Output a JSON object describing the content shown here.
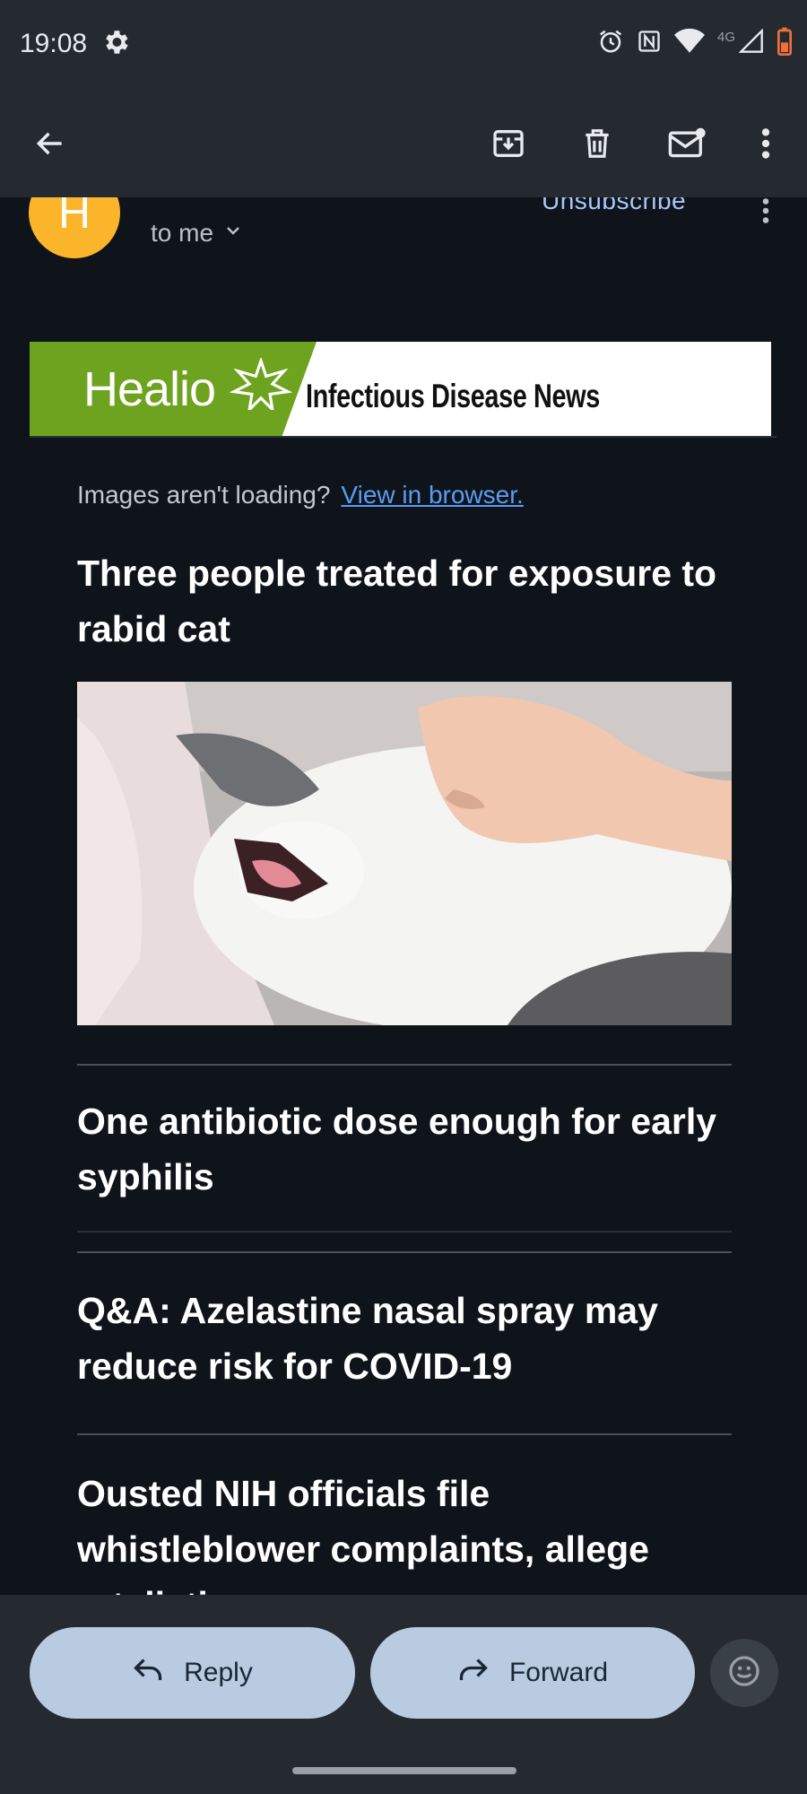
{
  "status_bar": {
    "time": "19:08",
    "network": "4G"
  },
  "email": {
    "sender_initial": "H",
    "recipient_label": "to me",
    "unsubscribe_label": "Unsubscribe"
  },
  "banner": {
    "brand": "Healio",
    "publication": "Infectious Disease News"
  },
  "content": {
    "images_notice": "Images aren't loading?",
    "view_in_browser": "View in browser.",
    "articles": [
      {
        "title": "Three people treated for exposure to rabid cat"
      },
      {
        "title": "One antibiotic dose enough for early syphilis"
      },
      {
        "title": "Q&A: Azelastine nasal spray may reduce risk for COVID-19"
      },
      {
        "title": "Ousted NIH officials file whistleblower complaints, allege retaliation"
      }
    ]
  },
  "actions": {
    "reply": "Reply",
    "forward": "Forward"
  },
  "colors": {
    "avatar": "#fbb52a",
    "brand_green": "#6ea31f",
    "link": "#5a9cf5",
    "action_pill": "#b8cbe0"
  },
  "icons": [
    "gear-icon",
    "alarm-icon",
    "nfc-icon",
    "wifi-icon",
    "cell-signal-icon",
    "battery-icon",
    "back-arrow-icon",
    "archive-icon",
    "delete-icon",
    "mark-unread-icon",
    "more-vert-icon",
    "chevron-down-icon",
    "reply-icon",
    "forward-icon",
    "emoji-icon"
  ]
}
